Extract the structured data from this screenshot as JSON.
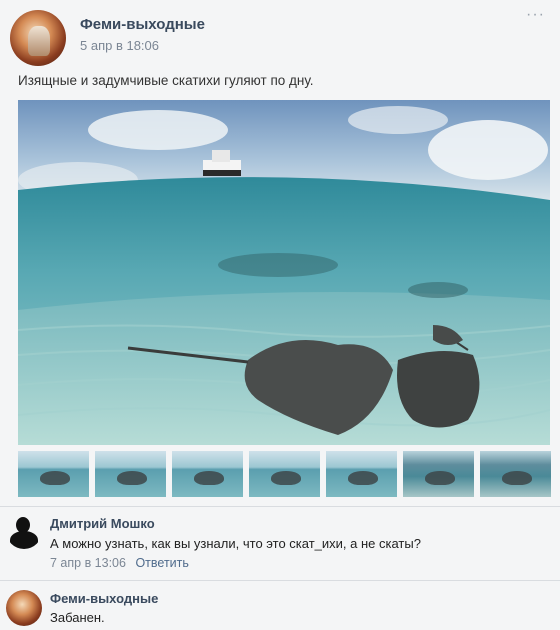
{
  "post": {
    "author": "Феми-выходные",
    "date": "5 апр в 18:06",
    "menu_glyph": "···",
    "text": "Изящные и задумчивые скатихи гуляют по дну."
  },
  "thumbnails_count": 7,
  "comments": [
    {
      "author": "Дмитрий Мошко",
      "text": "А можно узнать, как вы узнали, что это скат_ихи, а не скаты?",
      "date": "7 апр в 13:06",
      "reply_label": "Ответить"
    },
    {
      "author": "Феми-выходные",
      "text": "Забанен."
    }
  ],
  "icons": {
    "post_avatar": "community-avatar-icon",
    "commenter_avatar": "person-silhouette-icon"
  },
  "colors": {
    "author": "#3a4a5e",
    "meta": "#7b8694",
    "link": "#4f6b8c",
    "background": "#f4f5f6"
  }
}
